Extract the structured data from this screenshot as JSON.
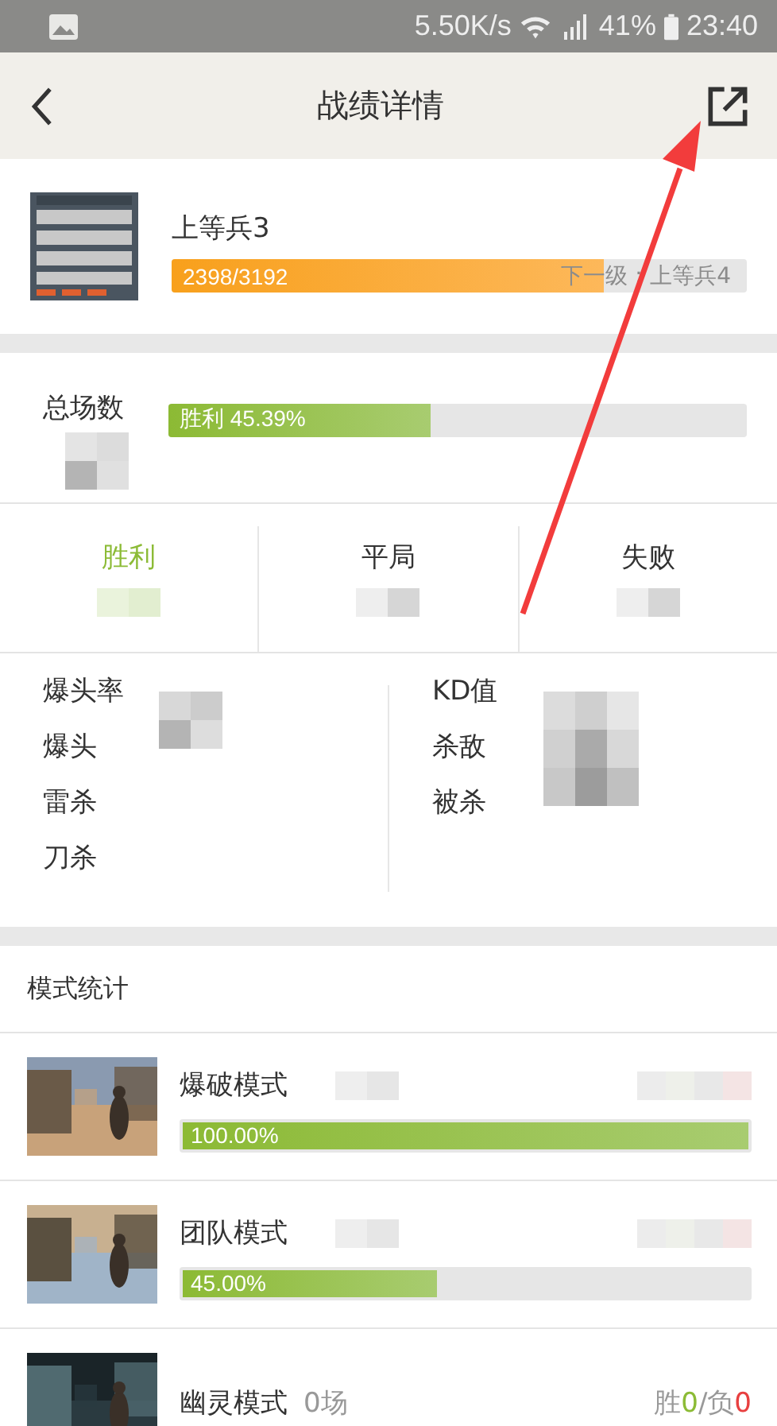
{
  "status_bar": {
    "speed": "5.50K/s",
    "battery": "41%",
    "time": "23:40"
  },
  "header": {
    "title": "战绩详情"
  },
  "rank": {
    "name": "上等兵3",
    "progress": "2398/3192",
    "level": 0.751,
    "next": "下一级：上等兵4"
  },
  "total": {
    "label": "总场数",
    "bar_text": "胜利 45.39%",
    "level": 0.4539
  },
  "tabs": [
    {
      "label": "胜利",
      "selected": true
    },
    {
      "label": "平局",
      "selected": false
    },
    {
      "label": "失败",
      "selected": false
    }
  ],
  "stats_left": [
    "爆头率",
    "爆头",
    "雷杀",
    "刀杀"
  ],
  "stats_right": [
    "KD值",
    "杀敌",
    "被杀"
  ],
  "modes_title": "模式统计",
  "modes": [
    {
      "name": "爆破模式",
      "bar_text": "100.00%",
      "level": 1.0,
      "kind": "redacted"
    },
    {
      "name": "团队模式",
      "bar_text": "45.00%",
      "level": 0.45,
      "kind": "redacted"
    },
    {
      "name": "幽灵模式",
      "count": "0场",
      "win_label": "胜",
      "wins": "0",
      "sep": "/",
      "loss_label": "负",
      "losses": "0",
      "kind": "plain"
    }
  ]
}
